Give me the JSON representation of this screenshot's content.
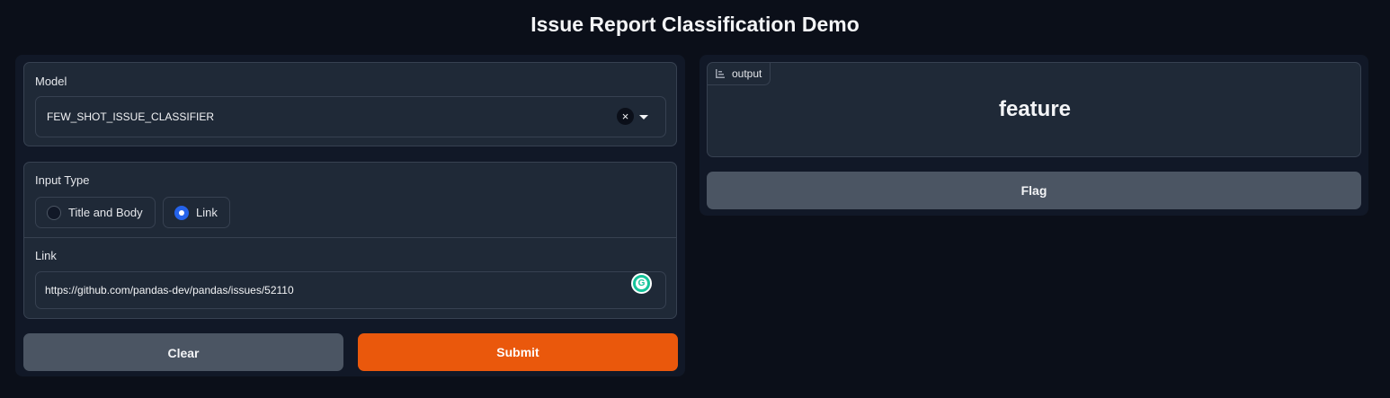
{
  "page": {
    "title": "Issue Report Classification Demo"
  },
  "model": {
    "label": "Model",
    "value": "FEW_SHOT_ISSUE_CLASSIFIER",
    "clear_icon": "×"
  },
  "input_type": {
    "label": "Input Type",
    "options": [
      {
        "label": "Title and Body",
        "checked": false
      },
      {
        "label": "Link",
        "checked": true
      }
    ]
  },
  "link": {
    "label": "Link",
    "value": "https://github.com/pandas-dev/pandas/issues/52110"
  },
  "buttons": {
    "clear": "Clear",
    "submit": "Submit",
    "flag": "Flag"
  },
  "output": {
    "label": "output",
    "value": "feature"
  },
  "colors": {
    "accent": "#ea580c",
    "radio_checked": "#2563eb",
    "background": "#0b0f19"
  }
}
